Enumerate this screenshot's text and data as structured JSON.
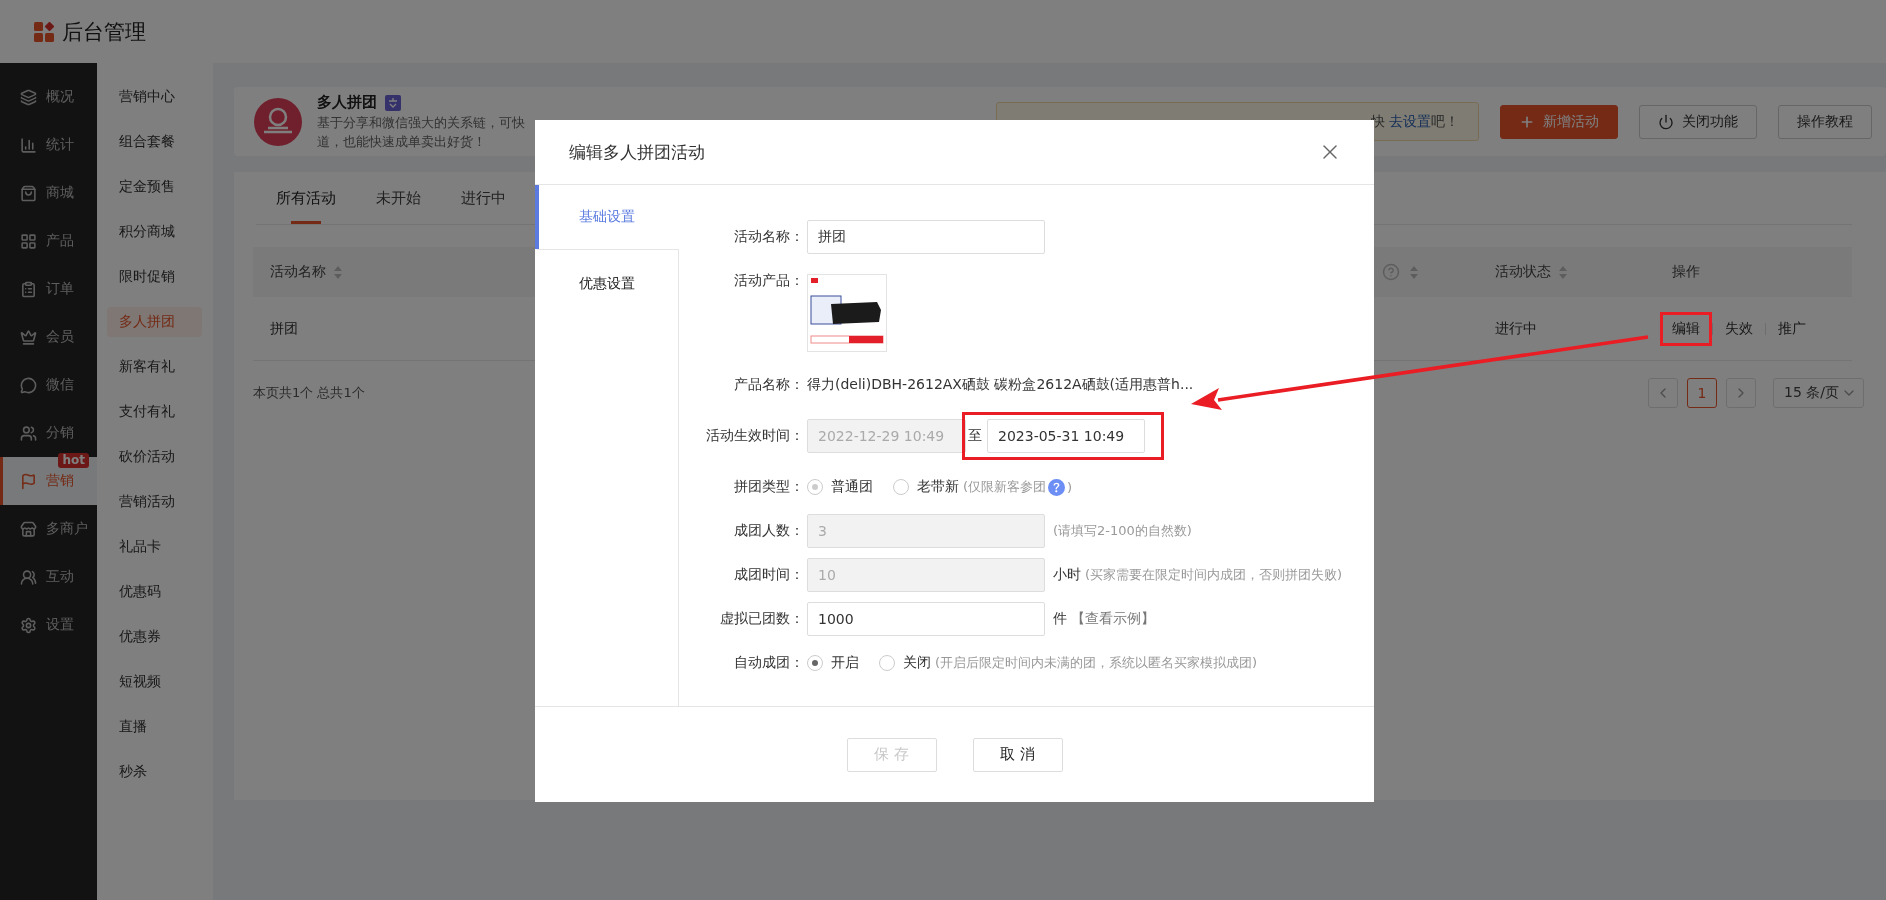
{
  "header": {
    "title": "后台管理"
  },
  "sidebar": {
    "items": [
      {
        "label": "概况",
        "selected": false
      },
      {
        "label": "统计",
        "selected": false
      },
      {
        "label": "商城",
        "selected": false
      },
      {
        "label": "产品",
        "selected": false
      },
      {
        "label": "订单",
        "selected": false
      },
      {
        "label": "会员",
        "selected": false
      },
      {
        "label": "微信",
        "selected": false
      },
      {
        "label": "分销",
        "selected": false
      },
      {
        "label": "营销",
        "selected": true,
        "badge": "hot"
      },
      {
        "label": "多商户",
        "selected": false
      },
      {
        "label": "互动",
        "selected": false
      },
      {
        "label": "设置",
        "selected": false
      }
    ]
  },
  "submenu": {
    "items": [
      {
        "label": "营销中心",
        "selected": false
      },
      {
        "label": "组合套餐",
        "selected": false
      },
      {
        "label": "定金预售",
        "selected": false
      },
      {
        "label": "积分商城",
        "selected": false
      },
      {
        "label": "限时促销",
        "selected": false
      },
      {
        "label": "多人拼团",
        "selected": true
      },
      {
        "label": "新客有礼",
        "selected": false
      },
      {
        "label": "支付有礼",
        "selected": false
      },
      {
        "label": "砍价活动",
        "selected": false
      },
      {
        "label": "营销活动",
        "selected": false
      },
      {
        "label": "礼品卡",
        "selected": false
      },
      {
        "label": "优惠码",
        "selected": false
      },
      {
        "label": "优惠券",
        "selected": false
      },
      {
        "label": "短视频",
        "selected": false
      },
      {
        "label": "直播",
        "selected": false
      },
      {
        "label": "秒杀",
        "selected": false
      }
    ]
  },
  "plugin": {
    "title": "多人拼团",
    "description_lines": [
      "基于分享和微信强大的关系链，可快",
      "道，也能快速成单卖出好货！"
    ],
    "notice": {
      "text": "快",
      "link": "去设置",
      "suffix": "吧！"
    },
    "buttons": [
      {
        "label": "新增活动",
        "kind": "primary"
      },
      {
        "label": "关闭功能",
        "kind": "power"
      },
      {
        "label": "操作教程",
        "kind": "plain"
      }
    ]
  },
  "tabs": [
    {
      "label": "所有活动",
      "selected": true
    },
    {
      "label": "未开始",
      "selected": false
    },
    {
      "label": "进行中",
      "selected": false
    }
  ],
  "table": {
    "columns": [
      {
        "label": "活动名称",
        "sortable": true
      },
      {
        "sortable": true,
        "help": true
      },
      {
        "label": "活动状态",
        "sortable": true
      },
      {
        "label": "操作",
        "sortable": false
      }
    ],
    "rows": [
      {
        "name": "拼团",
        "status": "进行中",
        "actions": [
          {
            "label": "编辑",
            "highlighted": true
          },
          {
            "label": "失效",
            "highlighted": false
          },
          {
            "label": "推广",
            "highlighted": false
          }
        ]
      }
    ]
  },
  "footer": {
    "summary": "本页共1个 总共1个",
    "pages": [
      {
        "label": "1",
        "selected": true
      }
    ],
    "page_size": "15 条/页"
  },
  "modal": {
    "title": "编辑多人拼团活动",
    "tabs": [
      {
        "label": "基础设置",
        "selected": true
      },
      {
        "label": "优惠设置",
        "selected": false
      }
    ],
    "fields": [
      {
        "kind": "input",
        "label": "活动名称：",
        "value": "拼团",
        "disabled": false
      },
      {
        "kind": "product",
        "label": "活动产品："
      },
      {
        "kind": "text",
        "label": "产品名称：",
        "value": "得力(deli)DBH-2612AX硒鼓 碳粉盒2612A硒鼓(适用惠普h..."
      },
      {
        "kind": "daterange",
        "label": "活动生效时间：",
        "start": "2022-12-29 10:49",
        "start_disabled": true,
        "separator": "至",
        "end": "2023-05-31 10:49",
        "highlighted": true
      },
      {
        "kind": "radio",
        "label": "拼团类型：",
        "disabled": true,
        "options": [
          {
            "label": "普通团",
            "selected": true
          },
          {
            "label": "老带新",
            "selected": false
          }
        ],
        "hint": "(仅限新客参团",
        "help": true,
        "hint_close": ")"
      },
      {
        "kind": "input",
        "label": "成团人数：",
        "value": "3",
        "disabled": true,
        "hint": "(请填写2-100的自然数)"
      },
      {
        "kind": "input",
        "label": "成团时间：",
        "value": "10",
        "disabled": true,
        "unit": "小时",
        "hint": "(买家需要在限定时间内成团，否则拼团失败)"
      },
      {
        "kind": "input",
        "label": "虚拟已团数：",
        "value": "1000",
        "disabled": false,
        "unit": "件",
        "link": "【查看示例】"
      },
      {
        "kind": "radio",
        "label": "自动成团：",
        "disabled": false,
        "options": [
          {
            "label": "开启",
            "selected": true
          },
          {
            "label": "关闭",
            "selected": false
          }
        ],
        "hint": "(开启后限定时间内未满的团，系统以匿名买家模拟成团)"
      }
    ],
    "buttons": [
      {
        "label": "保 存",
        "disabled": true
      },
      {
        "label": "取 消",
        "disabled": false
      }
    ]
  }
}
